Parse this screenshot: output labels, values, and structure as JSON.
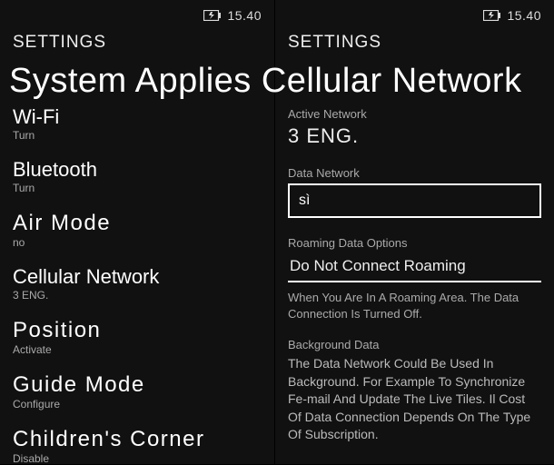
{
  "status": {
    "time": "15.40"
  },
  "left": {
    "header": "SETTINGS",
    "items": [
      {
        "title": "Wi-Fi",
        "sub": "Turn"
      },
      {
        "title": "Bluetooth",
        "sub": "Turn"
      },
      {
        "title": "Air Mode",
        "sub": "no",
        "spaced": true
      },
      {
        "title": "Cellular Network",
        "sub": "3 ENG."
      },
      {
        "title": "Position",
        "sub": "Activate",
        "spaced": true
      },
      {
        "title": "Guide Mode",
        "sub": "Configure",
        "spaced": true
      },
      {
        "title": "Children's Corner",
        "sub": "Disable",
        "spaced": true
      }
    ]
  },
  "right": {
    "header": "SETTINGS",
    "active_label": "Active Network",
    "active_value": "3 ENG.",
    "data_network_label": "Data Network",
    "data_network_value": "sì",
    "roaming_label": "Roaming Data Options",
    "roaming_value": "Do Not Connect Roaming",
    "roaming_helper": "When You Are In A Roaming Area. The Data Connection Is Turned Off.",
    "bg_label": "Background Data",
    "bg_text": "The Data Network Could Be Used In Background. For Example To Synchronize Fe-mail And Update The Live Tiles. Il Cost Of Data Connection Depends On The Type Of Subscription."
  },
  "overlay": "System Applies Cellular Network"
}
